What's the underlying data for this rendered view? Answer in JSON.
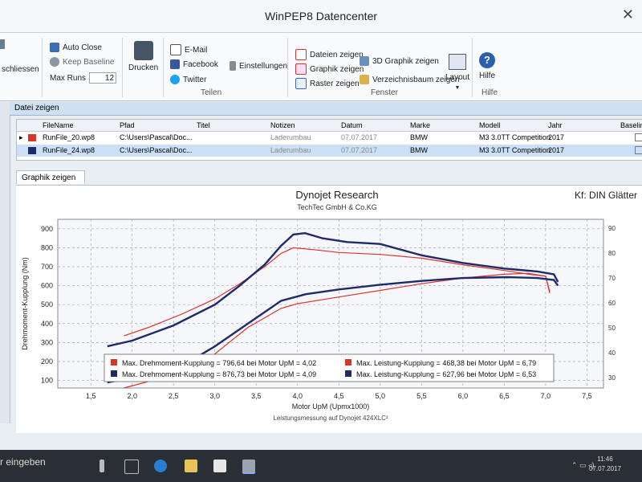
{
  "window": {
    "title": "WinPEP8 Datencenter",
    "close_glyph": "✕"
  },
  "ribbon": {
    "schliessen": "schliessen",
    "auto_close": "Auto Close",
    "keep_baseline": "Keep Baseline",
    "max_runs_label": "Max Runs",
    "max_runs_value": "12",
    "drucken": "Drucken",
    "email": "E-Mail",
    "facebook": "Facebook",
    "twitter": "Twitter",
    "einstellungen": "Einstellungen",
    "teilen_group": "Teilen",
    "dateien_zeigen": "Dateien zeigen",
    "graphik_zeigen": "Graphik zeigen",
    "raster_zeigen": "Raster zeigen",
    "graphik_3d": "3D Graphik zeigen",
    "verzeichnisbaum": "Verzeichnisbaum zeigen",
    "layout": "Layout",
    "fenster_group": "Fenster",
    "hilfe": "Hilfe",
    "hilfe_group": "Hilfe"
  },
  "file_panel": {
    "title": "Datei zeigen",
    "columns": [
      "FileName",
      "Pfad",
      "Titel",
      "Notizen",
      "Datum",
      "Marke",
      "Modell",
      "Jahr",
      "Baseline"
    ],
    "rows": [
      {
        "color": "#d9362b",
        "filename": "RunFile_20.wp8",
        "path": "C:\\Users\\Pascal\\Doc...",
        "titel": "",
        "notizen": "Laderumbau",
        "datum": "07.07.2017",
        "marke": "BMW",
        "modell": "M3 3.0TT Competition",
        "jahr": "2017"
      },
      {
        "color": "#1f2a6b",
        "filename": "RunFile_24.wp8",
        "path": "C:\\Users\\Pascal\\Doc...",
        "titel": "",
        "notizen": "Laderumbau",
        "datum": "07.07.2017",
        "marke": "BMW",
        "modell": "M3 3.0TT Competition",
        "jahr": "2017"
      }
    ]
  },
  "graph_tab": {
    "label": "Graphik zeigen",
    "close": "✕"
  },
  "chart_data": {
    "type": "line",
    "title": "Dynojet Research",
    "subtitle": "TechTec GmbH & Co.KG",
    "corner_label": "Kf: DIN Glätter",
    "xlabel": "Motor UpM (Upmx1000)",
    "ylabel": "Drehmoment-Kupplung (Nm)",
    "footer": "Leistungsmessung auf Dynojet 424XLC²",
    "xlim": [
      1.1,
      7.7
    ],
    "ylim": [
      60,
      950
    ],
    "xticks": [
      "1,5",
      "2,0",
      "2,5",
      "3,0",
      "3,5",
      "4,0",
      "4,5",
      "5,0",
      "5,5",
      "6,0",
      "6,5",
      "7,0",
      "7,5"
    ],
    "yticks": [
      "100",
      "200",
      "300",
      "400",
      "500",
      "600",
      "700",
      "800",
      "900"
    ],
    "grid": true,
    "series": [
      {
        "color": "#d9362b",
        "kind": "torque",
        "x": [
          1.9,
          2.2,
          2.6,
          3.0,
          3.3,
          3.6,
          3.8,
          3.95,
          4.02,
          4.2,
          4.5,
          5.0,
          5.5,
          6.0,
          6.5,
          6.8,
          7.0,
          7.05
        ],
        "y": [
          335,
          380,
          450,
          530,
          610,
          700,
          770,
          800,
          797,
          790,
          775,
          765,
          745,
          710,
          680,
          660,
          650,
          570
        ]
      },
      {
        "color": "#1f2a6b",
        "kind": "torque",
        "x": [
          1.7,
          2.0,
          2.5,
          3.0,
          3.3,
          3.6,
          3.8,
          3.95,
          4.09,
          4.3,
          4.6,
          5.0,
          5.5,
          6.0,
          6.5,
          6.9,
          7.1,
          7.15
        ],
        "y": [
          280,
          310,
          390,
          500,
          600,
          710,
          810,
          870,
          877,
          850,
          830,
          820,
          760,
          720,
          690,
          675,
          660,
          620
        ]
      },
      {
        "color": "#d9362b",
        "kind": "power",
        "x": [
          1.9,
          2.5,
          3.0,
          3.4,
          3.8,
          4.0,
          4.5,
          5.0,
          5.5,
          6.0,
          6.5,
          6.79,
          7.0,
          7.05
        ],
        "y": [
          60,
          130,
          240,
          380,
          480,
          505,
          540,
          575,
          610,
          640,
          660,
          665,
          650,
          560
        ]
      },
      {
        "color": "#1f2a6b",
        "kind": "power",
        "x": [
          1.7,
          2.5,
          3.0,
          3.4,
          3.8,
          4.1,
          4.5,
          5.0,
          5.5,
          6.0,
          6.53,
          6.9,
          7.1,
          7.15
        ],
        "y": [
          90,
          150,
          280,
          400,
          520,
          555,
          580,
          605,
          625,
          640,
          645,
          640,
          630,
          600
        ]
      }
    ],
    "legend": [
      {
        "color": "#d9362b",
        "text": "Max. Drehmoment-Kupplung = 796,64 bei Motor UpM = 4,02"
      },
      {
        "color": "#1f2a6b",
        "text": "Max. Drehmoment-Kupplung = 876,73 bei Motor UpM = 4,09"
      },
      {
        "color": "#d9362b",
        "text": "Max. Leistung-Kupplung = 468,38 bei Motor UpM = 6,79"
      },
      {
        "color": "#1f2a6b",
        "text": "Max. Leistung-Kupplung = 627,96 bei Motor UpM = 6,53"
      }
    ],
    "right_ticks": [
      "90",
      "80",
      "70",
      "60",
      "50",
      "40",
      "30"
    ]
  },
  "taskbar": {
    "search": "r eingeben",
    "time": "11:46",
    "date": "07.07.2017"
  }
}
